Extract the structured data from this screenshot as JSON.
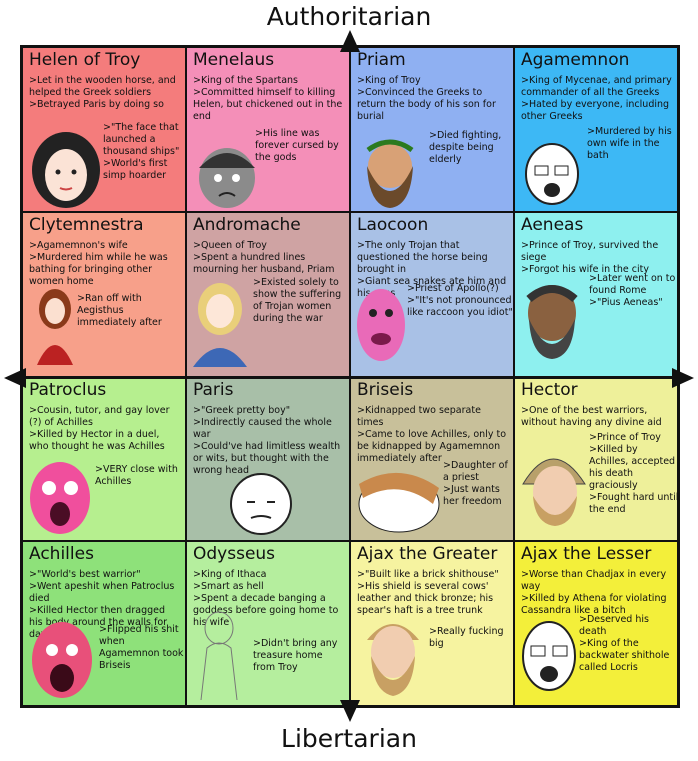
{
  "axes": {
    "top": "Authoritarian",
    "bottom": "Libertarian"
  },
  "cells": [
    {
      "name": "Helen of Troy",
      "color": "#f47c7c",
      "lines": [
        ">Let in the wooden horse, and helped the Greek soldiers",
        ">Betrayed Paris by doing so"
      ],
      "extra": [
        ">\"The face that launched a thousand ships\"",
        ">World's first simp hoarder"
      ]
    },
    {
      "name": "Menelaus",
      "color": "#f48fb8",
      "lines": [
        ">King of the Spartans",
        ">Committed himself to killing Helen, but chickened out in the end"
      ],
      "extra": [
        ">His line was forever cursed by the gods"
      ]
    },
    {
      "name": "Priam",
      "color": "#8fb0f2",
      "lines": [
        ">King of Troy",
        ">Convinced the Greeks to return the body of his son for burial"
      ],
      "extra": [
        ">Died fighting, despite being elderly"
      ]
    },
    {
      "name": "Agamemnon",
      "color": "#3db8f5",
      "lines": [
        ">King of Mycenae, and primary commander of all the Greeks",
        ">Hated by everyone, including other Greeks"
      ],
      "extra": [
        ">Murdered by his own wife in the bath"
      ]
    },
    {
      "name": "Clytemnestra",
      "color": "#f7a08a",
      "lines": [
        ">Agamemnon's wife",
        ">Murdered him while he was bathing for bringing other women home"
      ],
      "extra": [
        ">Ran off with Aegisthus immediately after"
      ]
    },
    {
      "name": "Andromache",
      "color": "#cfa3a3",
      "lines": [
        ">Queen of Troy",
        ">Spent a hundred lines mourning her husband, Priam"
      ],
      "extra": [
        ">Existed solely to show the suffering of Trojan women during the war"
      ]
    },
    {
      "name": "Laocoon",
      "color": "#a9c1e6",
      "lines": [
        ">The only Trojan that questioned the horse being brought in",
        ">Giant sea snakes ate him and his sons"
      ],
      "extra": [
        ">Priest of Apollo(?)",
        ">\"It's not pronounced like raccoon you idiot\""
      ]
    },
    {
      "name": "Aeneas",
      "color": "#8ef0ef",
      "lines": [
        ">Prince of Troy, survived the siege",
        ">Forgot his wife in the city"
      ],
      "extra": [
        ">Later went on to found Rome",
        ">\"Pius Aeneas\""
      ]
    },
    {
      "name": "Patroclus",
      "color": "#b6ef8f",
      "lines": [
        ">Cousin, tutor, and gay lover (?) of Achilles",
        ">Killed by Hector in a duel, who thought he was Achilles"
      ],
      "extra": [
        ">VERY close with Achilles"
      ]
    },
    {
      "name": "Paris",
      "color": "#a8bfa8",
      "lines": [
        ">\"Greek pretty boy\"",
        ">Indirectly caused the whole war",
        ">Could've had limitless wealth or wits, but thought with the wrong head"
      ],
      "extra": []
    },
    {
      "name": "Briseis",
      "color": "#c8c09a",
      "lines": [
        ">Kidnapped two separate times",
        ">Came to love Achilles, only to be kidnapped by Agamemnon immediately after"
      ],
      "extra": [
        ">Daughter of a priest",
        ">Just wants her freedom"
      ]
    },
    {
      "name": "Hector",
      "color": "#eef09a",
      "lines": [
        ">One of the best warriors, without having any divine aid"
      ],
      "extra": [
        ">Prince of Troy",
        ">Killed by Achilles, accepted his death graciously",
        ">Fought hard until the end"
      ]
    },
    {
      "name": "Achilles",
      "color": "#8ee17a",
      "lines": [
        ">\"World's best warrior\"",
        ">Went apeshit when Patroclus died",
        ">Killed Hector then dragged his body around the walls for days"
      ],
      "extra": [
        ">Flipped his shit when Agamemnon took Briseis"
      ]
    },
    {
      "name": "Odysseus",
      "color": "#b5ee9e",
      "lines": [
        ">King of Ithaca",
        ">Smart as hell",
        ">Spent a decade banging a goddess before going home to his wife"
      ],
      "extra": [
        ">Didn't bring any treasure home from Troy"
      ]
    },
    {
      "name": "Ajax the Greater",
      "color": "#f6f3a0",
      "lines": [
        ">\"Built like a brick shithouse\"",
        ">His shield is several cows' leather and thick bronze; his spear's haft is a tree trunk"
      ],
      "extra": [
        ">Really fucking big"
      ]
    },
    {
      "name": "Ajax the Lesser",
      "color": "#f3ef3a",
      "lines": [
        ">Worse than Chadjax in every way",
        ">Killed by Athena for violating Cassandra like a bitch"
      ],
      "extra": [
        ">Deserved his death",
        ">King of the backwater shithole called Locris"
      ]
    }
  ]
}
